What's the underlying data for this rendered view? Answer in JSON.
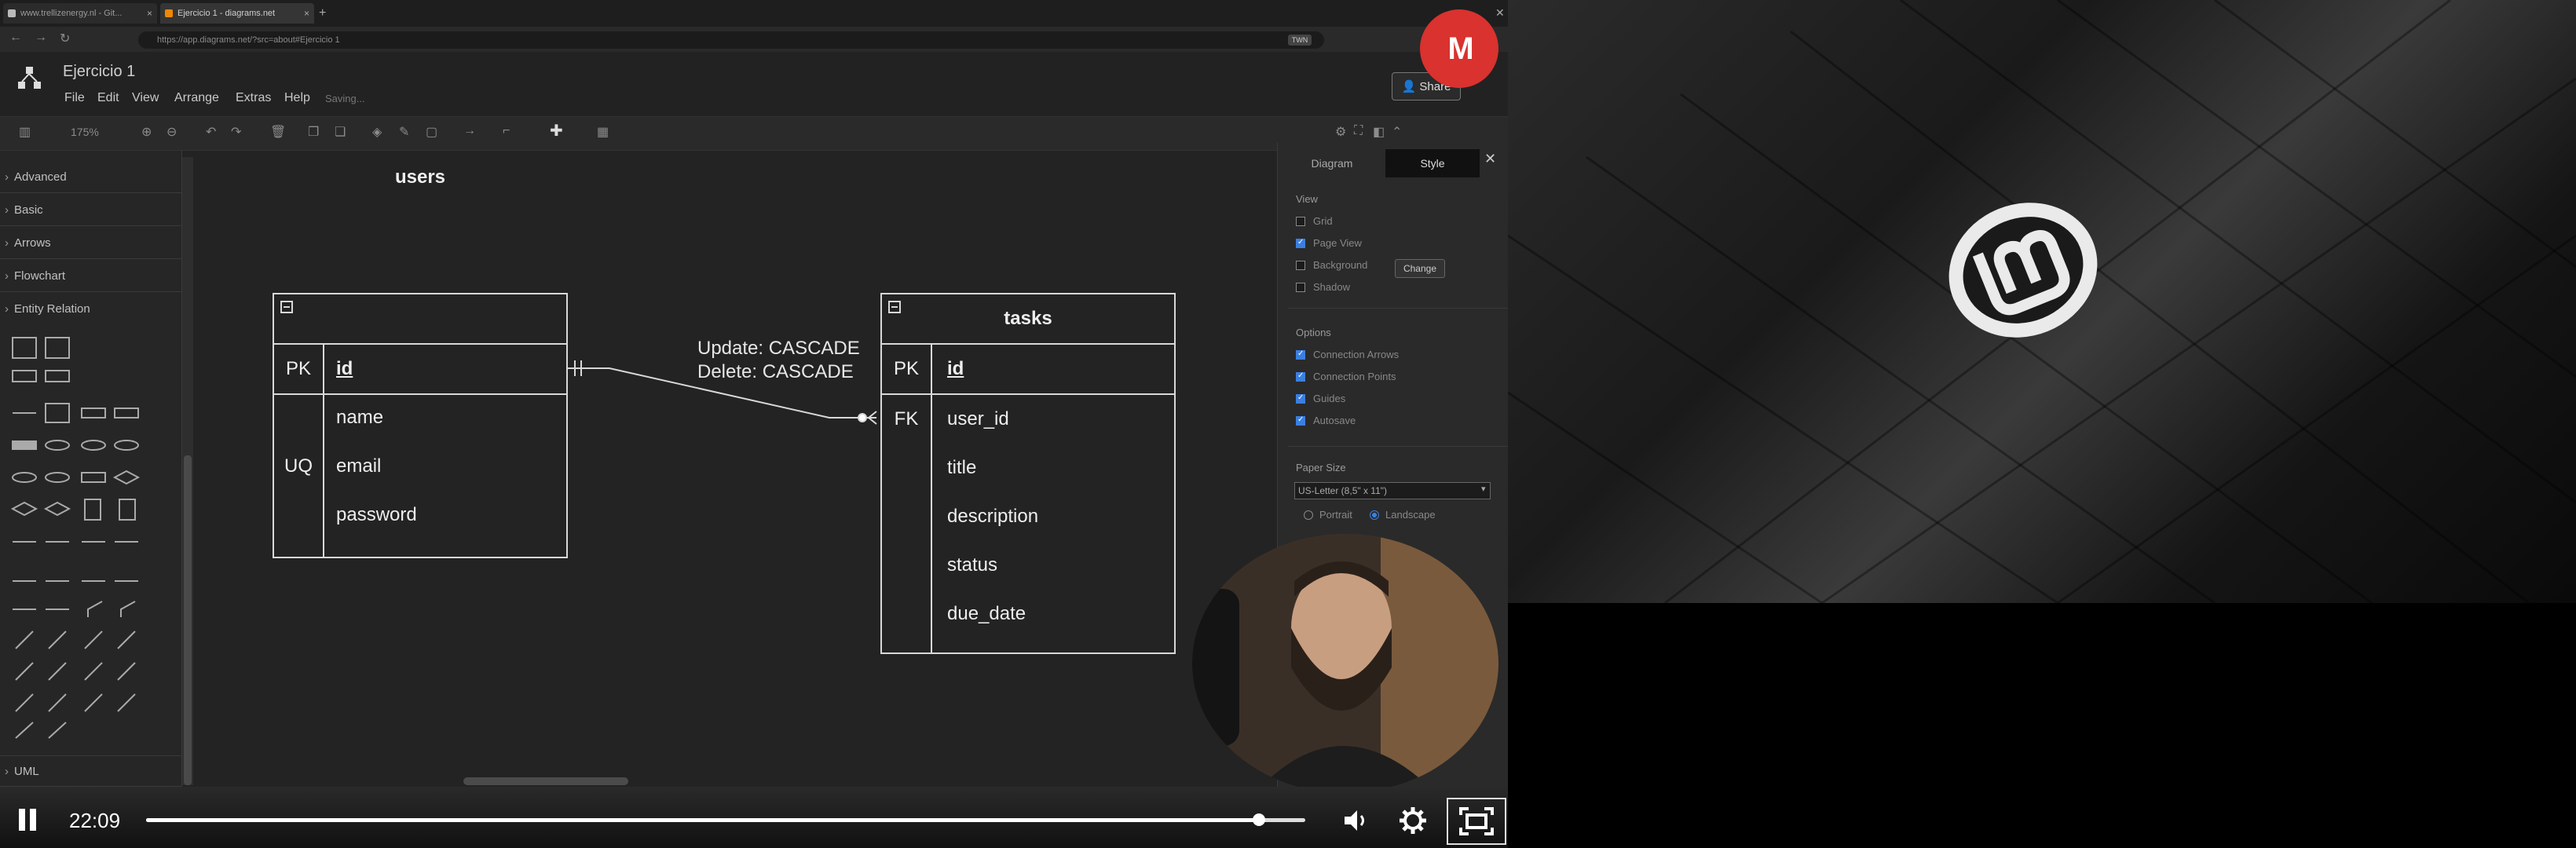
{
  "browser": {
    "tabs": [
      {
        "label": "www.trellizenergy.nl - Git..."
      },
      {
        "label": "Ejercicio 1 - diagrams.net"
      }
    ],
    "url": "https://app.diagrams.net/?src=about#Ejercicio 1",
    "badge": "TWN"
  },
  "app": {
    "title": "Ejercicio 1",
    "menu": [
      "File",
      "Edit",
      "View",
      "Arrange",
      "Extras",
      "Help"
    ],
    "status": "Saving...",
    "share_label": "Share",
    "zoom": "175%",
    "channel_logo": "M"
  },
  "sidebar": {
    "sections": [
      "Advanced",
      "Basic",
      "Arrows",
      "Flowchart",
      "Entity Relation"
    ],
    "bottom_section": "UML"
  },
  "diagram": {
    "users": {
      "title": "users",
      "rows": [
        {
          "key": "PK",
          "field": "id"
        },
        {
          "key": "",
          "field": "name"
        },
        {
          "key": "UQ",
          "field": "email"
        },
        {
          "key": "",
          "field": "password"
        }
      ]
    },
    "tasks": {
      "title": "tasks",
      "rows": [
        {
          "key": "PK",
          "field": "id"
        },
        {
          "key": "FK",
          "field": "user_id"
        },
        {
          "key": "",
          "field": "title"
        },
        {
          "key": "",
          "field": "description"
        },
        {
          "key": "",
          "field": "status"
        },
        {
          "key": "",
          "field": "due_date"
        }
      ]
    },
    "edge_label_update": "Update: CASCADE",
    "edge_label_delete": "Delete: CASCADE"
  },
  "format_panel": {
    "tabs": [
      "Diagram",
      "Style"
    ],
    "view_heading": "View",
    "view_options": [
      {
        "label": "Grid",
        "checked": false
      },
      {
        "label": "Page View",
        "checked": true
      },
      {
        "label": "Background",
        "checked": false
      },
      {
        "label": "Shadow",
        "checked": false
      }
    ],
    "change_label": "Change",
    "options_heading": "Options",
    "options": [
      {
        "label": "Connection Arrows",
        "checked": true
      },
      {
        "label": "Connection Points",
        "checked": true
      },
      {
        "label": "Guides",
        "checked": true
      },
      {
        "label": "Autosave",
        "checked": true
      }
    ],
    "paper_heading": "Paper Size",
    "paper_value": "US-Letter (8,5\" x 11\")",
    "orientation": [
      {
        "label": "Portrait",
        "checked": false
      },
      {
        "label": "Landscape",
        "checked": true
      }
    ]
  },
  "player": {
    "time": "22:09",
    "progress": 0.96
  },
  "colors": {
    "accent": "#3b7fe0",
    "channel_red": "#d9322f"
  }
}
